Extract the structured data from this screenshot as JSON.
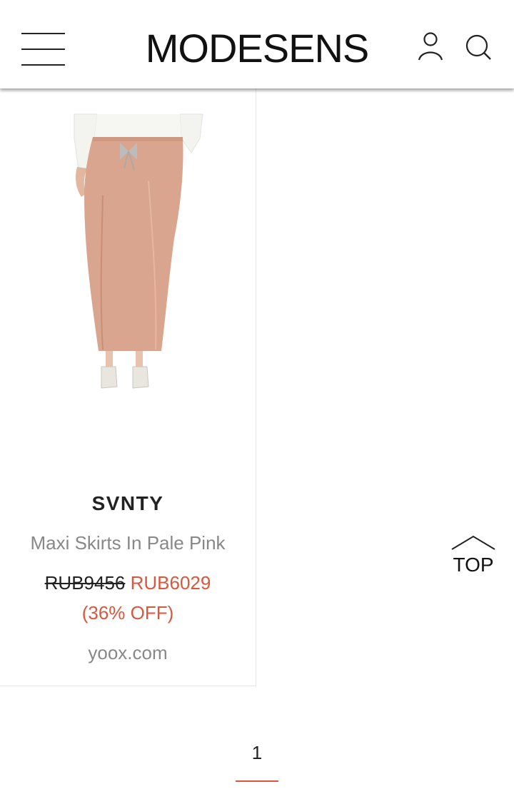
{
  "header": {
    "logo": "MODESENS",
    "menu_icon": "hamburger-icon",
    "user_icon": "user-icon",
    "search_icon": "search-icon"
  },
  "product": {
    "brand": "SVNTY",
    "title": "Maxi Skirts In Pale Pink",
    "original_price": "RUB9456",
    "sale_price": "RUB6029",
    "discount": "(36% OFF)",
    "store": "yoox.com",
    "image_icon": "product-photo"
  },
  "scroll_top": {
    "label": "TOP",
    "icon": "chevron-up-icon"
  },
  "pagination": {
    "current_page": "1"
  },
  "colors": {
    "sale": "#d9573c",
    "muted_text": "#888888",
    "skirt": "#d9a58e"
  }
}
